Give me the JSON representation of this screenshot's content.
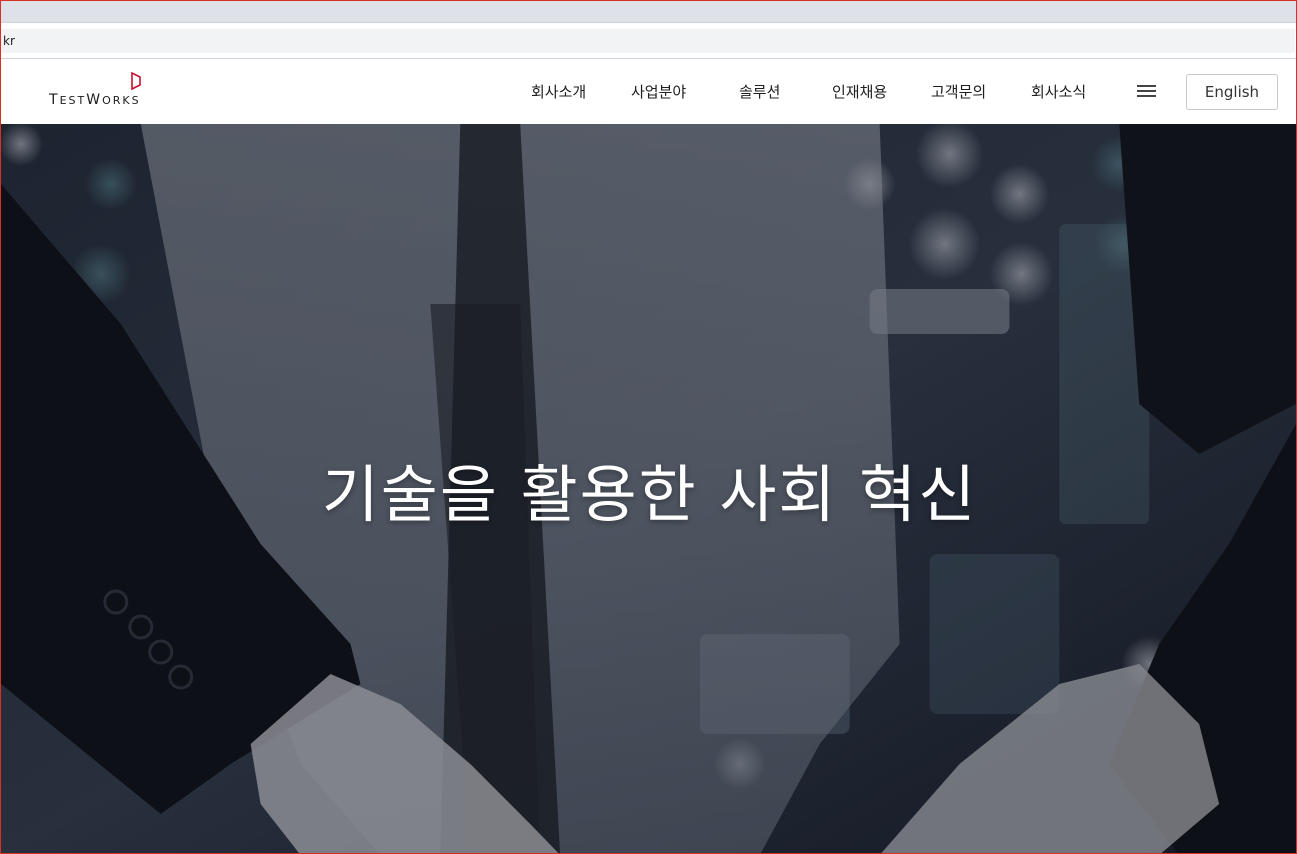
{
  "browser": {
    "address_text": "kr"
  },
  "header": {
    "logo_text_main": "TESTWORKS",
    "logo_text_display": [
      "T",
      "EST",
      "W",
      "ORKS"
    ],
    "logo_color": "#c8102e",
    "nav": [
      {
        "label": "회사소개"
      },
      {
        "label": "사업분야"
      },
      {
        "label": "솔루션"
      },
      {
        "label": "인재채용"
      },
      {
        "label": "고객문의"
      },
      {
        "label": "회사소식"
      }
    ],
    "menu_icon": "hamburger-icon",
    "language_button": "English"
  },
  "hero": {
    "title": "기술을 활용한 사회 혁신"
  },
  "colors": {
    "accent": "#c8102e",
    "frame_border": "#d93025",
    "header_bg": "#ffffff",
    "hero_text": "#ffffff"
  }
}
